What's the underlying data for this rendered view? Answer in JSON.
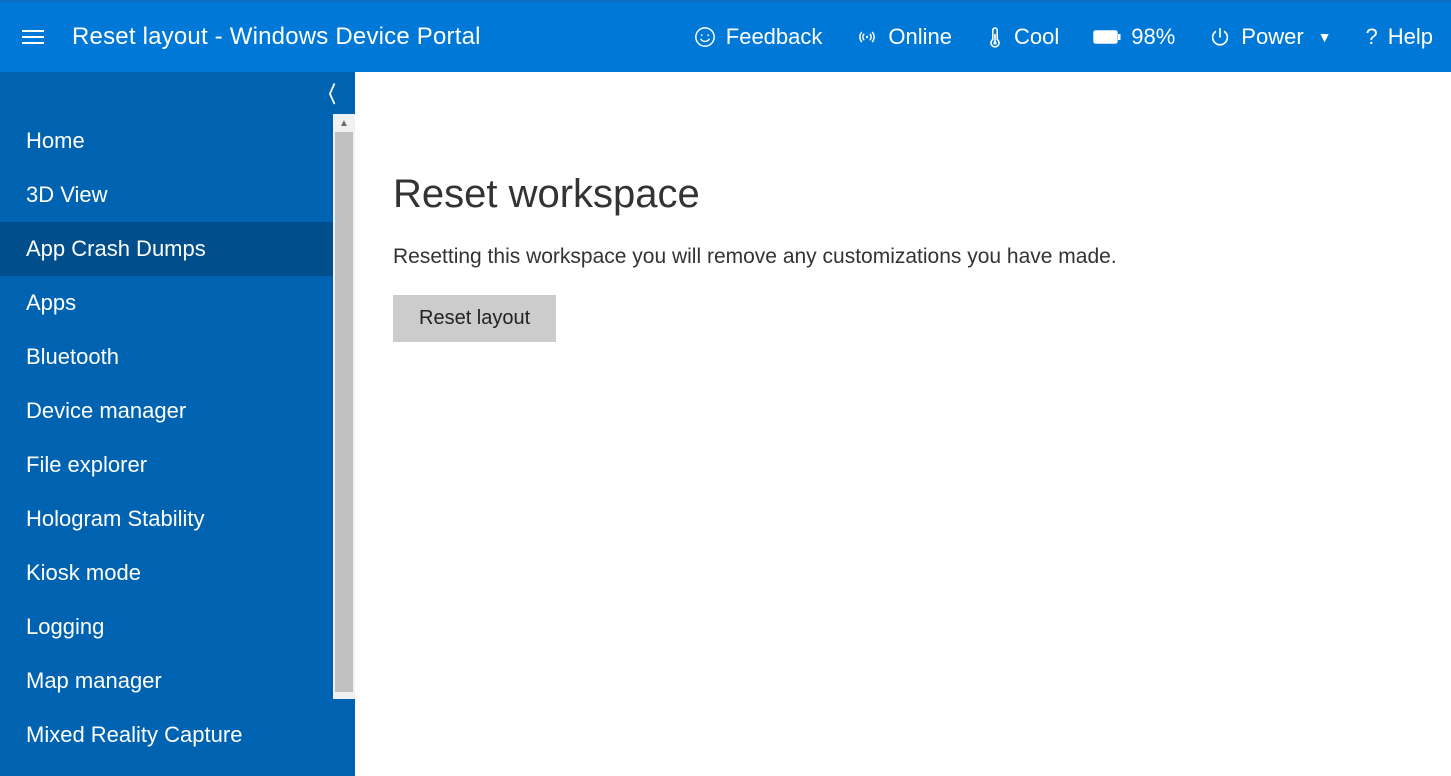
{
  "header": {
    "title": "Reset layout - Windows Device Portal",
    "feedback": "Feedback",
    "online": "Online",
    "cool": "Cool",
    "battery": "98%",
    "power": "Power",
    "help": "Help"
  },
  "sidebar": {
    "items": [
      {
        "label": "Home"
      },
      {
        "label": "3D View"
      },
      {
        "label": "App Crash Dumps"
      },
      {
        "label": "Apps"
      },
      {
        "label": "Bluetooth"
      },
      {
        "label": "Device manager"
      },
      {
        "label": "File explorer"
      },
      {
        "label": "Hologram Stability"
      },
      {
        "label": "Kiosk mode"
      },
      {
        "label": "Logging"
      },
      {
        "label": "Map manager"
      },
      {
        "label": "Mixed Reality Capture"
      }
    ],
    "active_index": 2
  },
  "main": {
    "heading": "Reset workspace",
    "description": "Resetting this workspace you will remove any customizations you have made.",
    "button": "Reset layout"
  }
}
